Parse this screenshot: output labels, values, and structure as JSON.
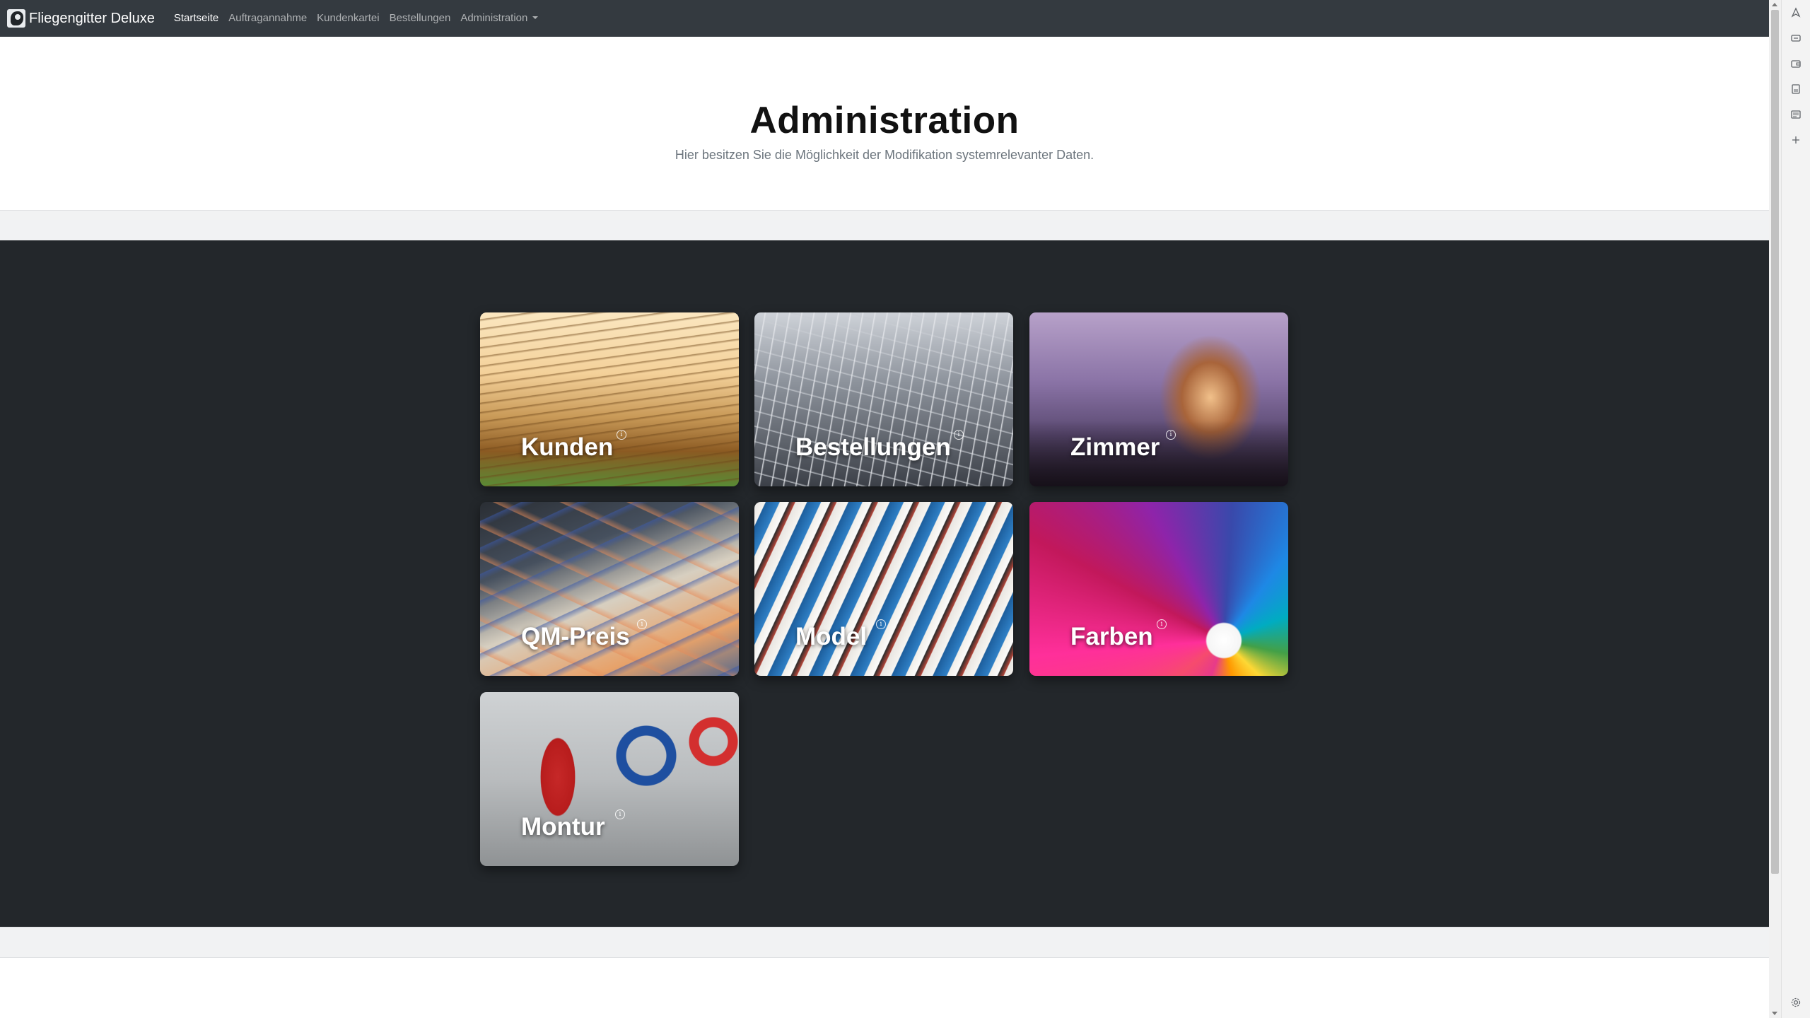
{
  "navbar": {
    "brand": "Fliegengitter Deluxe",
    "items": [
      {
        "label": "Startseite",
        "active": true
      },
      {
        "label": "Auftragannahme",
        "active": false
      },
      {
        "label": "Kundenkartei",
        "active": false
      },
      {
        "label": "Bestellungen",
        "active": false
      },
      {
        "label": "Administration",
        "active": false,
        "dropdown": true
      }
    ],
    "background": "#343a40"
  },
  "header": {
    "title": "Administration",
    "subtitle": "Hier besitzen Sie die Möglichkeit der Modifikation systemrelevanter Daten."
  },
  "cards": [
    {
      "label": "Kunden",
      "image": "stacked-paper-photo"
    },
    {
      "label": "Bestellungen",
      "image": "shopping-carts-photo"
    },
    {
      "label": "Zimmer",
      "image": "modern-house-photo"
    },
    {
      "label": "QM-Preis",
      "image": "euro-banknotes-photo"
    },
    {
      "label": "Model",
      "image": "magazines-photo"
    },
    {
      "label": "Farben",
      "image": "color-swatch-fan-photo"
    },
    {
      "label": "Montur",
      "image": "tools-photo"
    }
  ],
  "side_panel": {
    "icons": [
      "discover-icon",
      "read-aloud-icon",
      "wallet-icon",
      "save-icon",
      "reading-view-icon",
      "add-icon",
      "settings-icon"
    ]
  },
  "colors": {
    "dark_section": "#23272b",
    "band": "#f1f2f3",
    "subtitle": "#6c757d"
  }
}
